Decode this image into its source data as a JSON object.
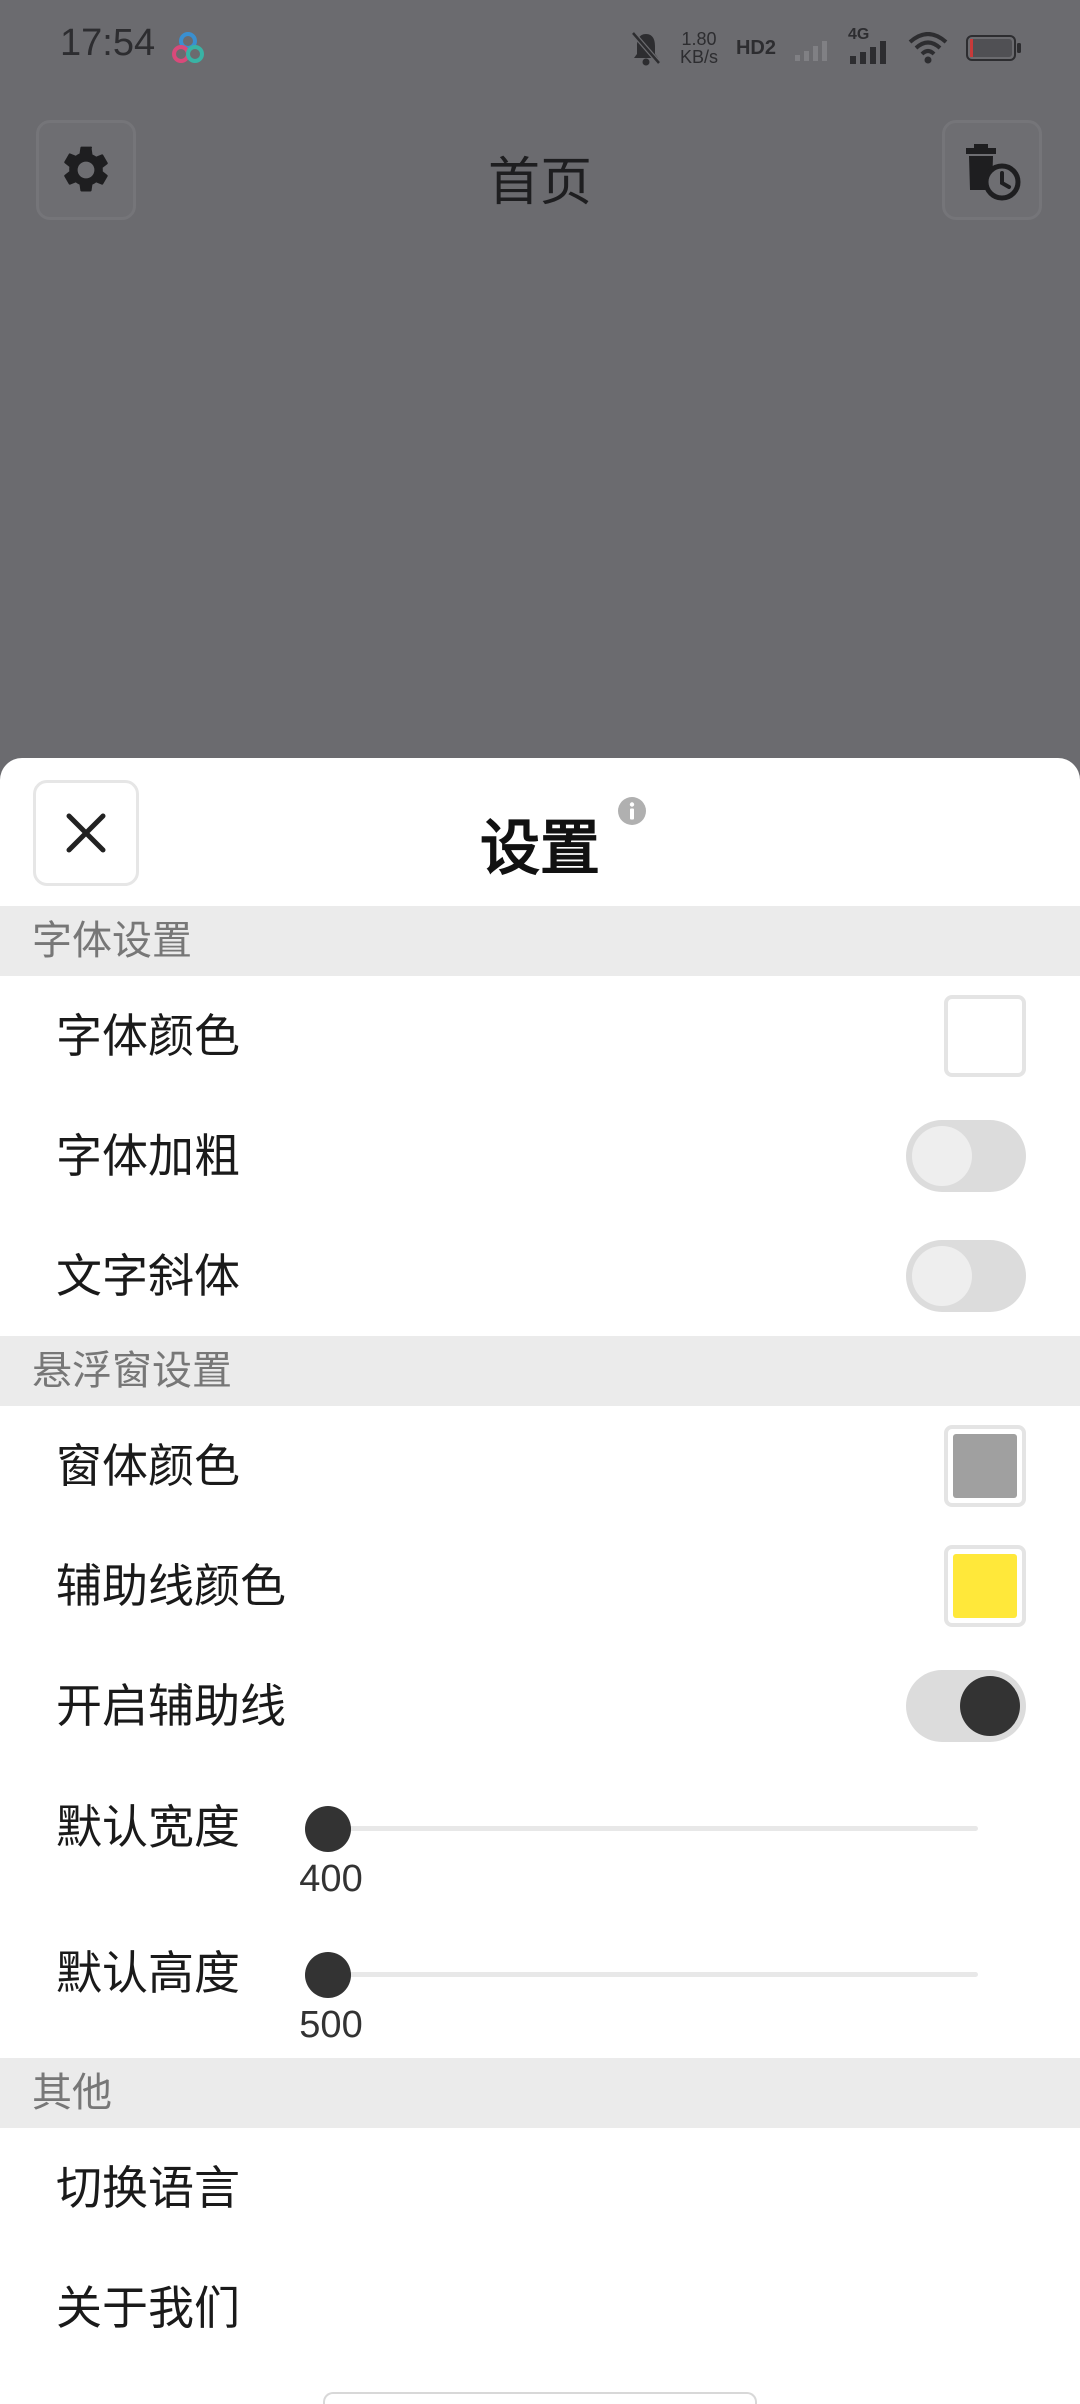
{
  "status_bar": {
    "time": "17:54",
    "net_speed_value": "1.80",
    "net_speed_unit": "KB/s",
    "hd_label": "HD2",
    "network_type": "4G"
  },
  "background_page": {
    "title": "首页"
  },
  "sheet": {
    "title": "设置",
    "sections": {
      "font": {
        "header": "字体设置",
        "font_color_label": "字体颜色",
        "font_color_value": "#ffffff",
        "bold_label": "字体加粗",
        "bold_on": false,
        "italic_label": "文字斜体",
        "italic_on": false
      },
      "floating": {
        "header": "悬浮窗设置",
        "window_color_label": "窗体颜色",
        "window_color_value": "#a0a0a0",
        "guide_color_label": "辅助线颜色",
        "guide_color_value": "#ffe83a",
        "guide_enable_label": "开启辅助线",
        "guide_enable_on": true,
        "width_label": "默认宽度",
        "width_value": "400",
        "width_fraction": 0.0,
        "height_label": "默认高度",
        "height_value": "500",
        "height_fraction": 0.0
      },
      "other": {
        "header": "其他",
        "language_label": "切换语言",
        "about_label": "关于我们"
      }
    }
  }
}
